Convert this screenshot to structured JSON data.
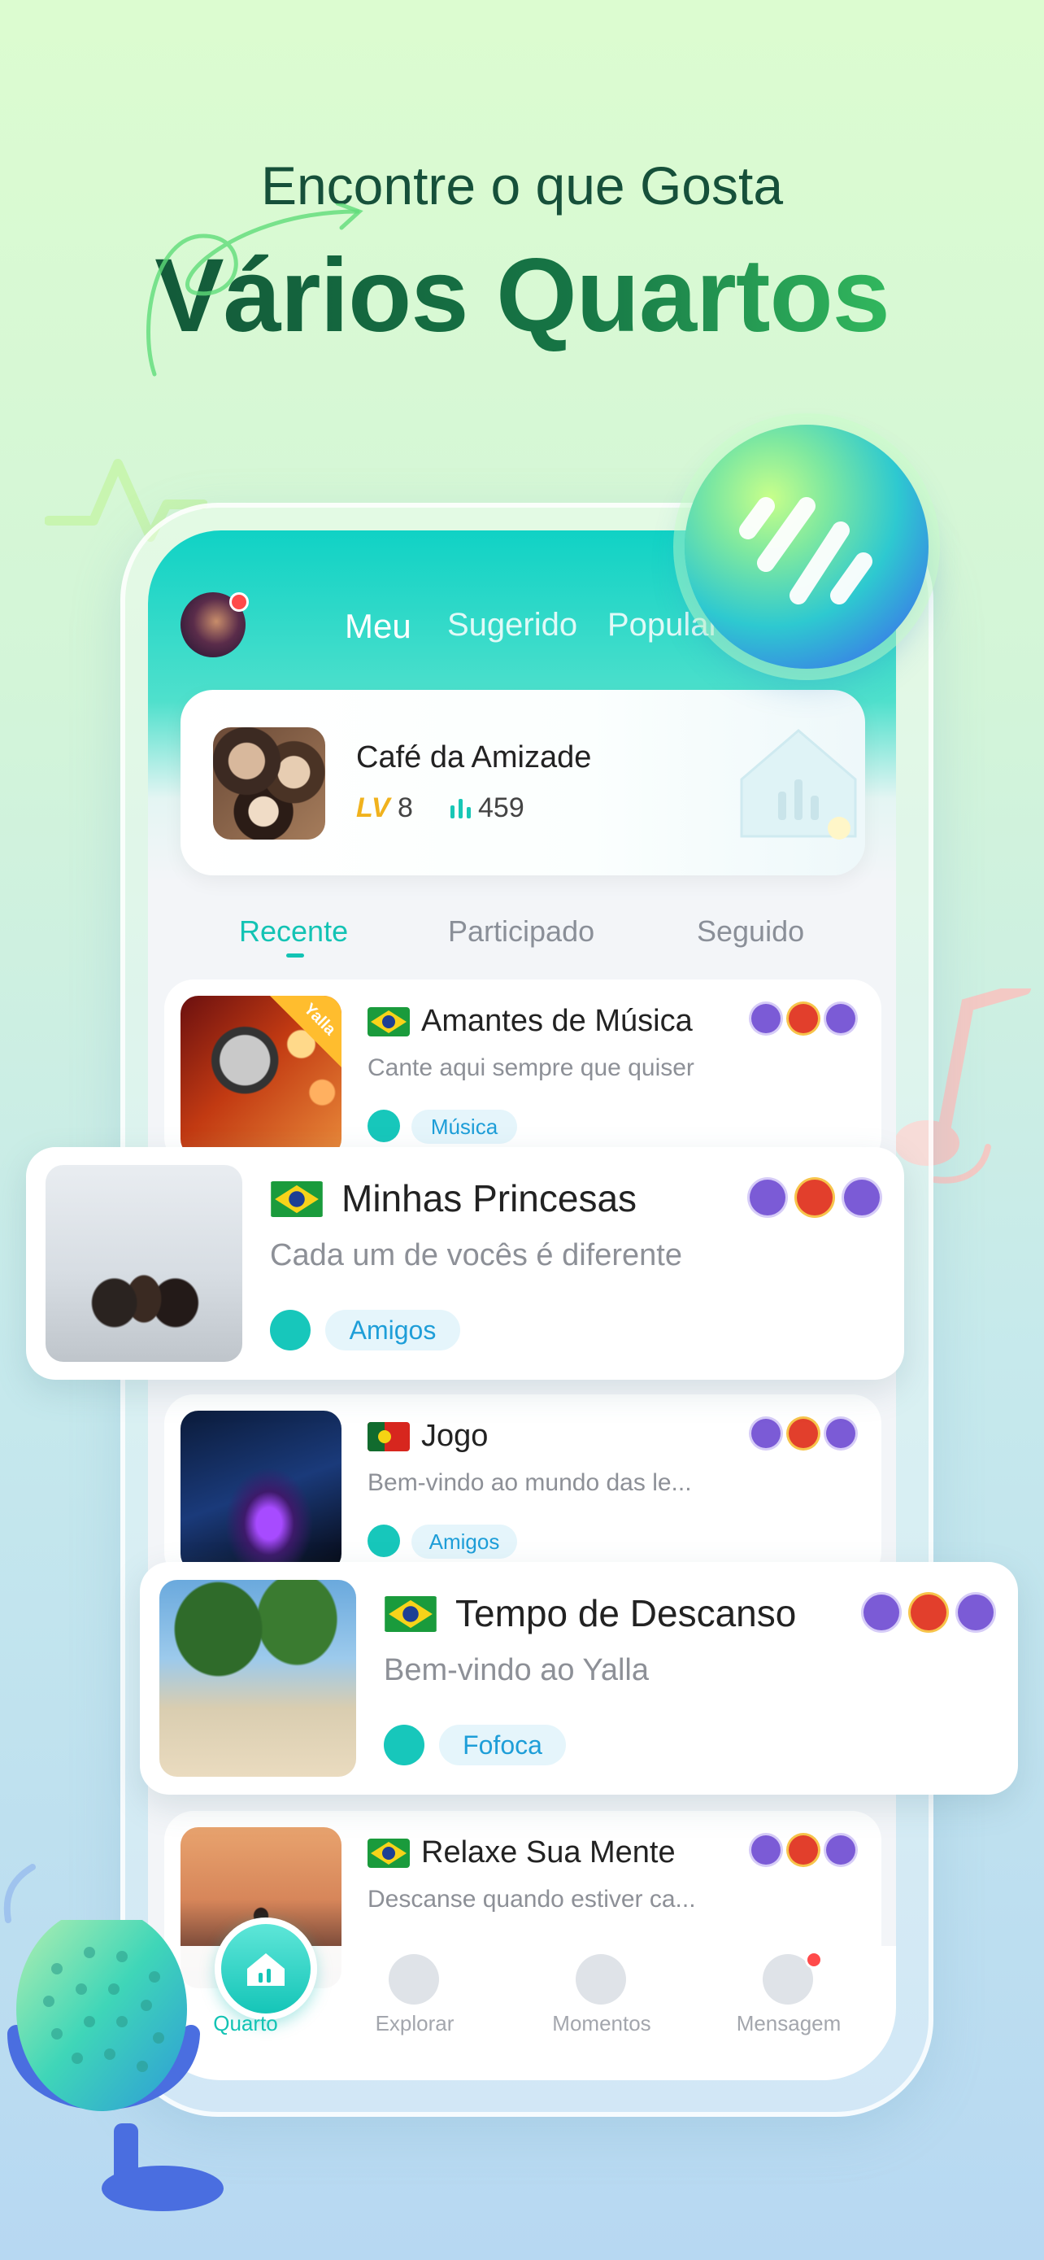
{
  "header": {
    "subtitle": "Encontre o que Gosta",
    "title": "Vários Quartos"
  },
  "top_tabs": [
    {
      "label": "Meu"
    },
    {
      "label": "Sugerido"
    },
    {
      "label": "Popular"
    }
  ],
  "favorite_room": {
    "name": "Café da Amizade",
    "level_mark": "LV",
    "level": "8",
    "count": "459"
  },
  "sub_tabs": [
    {
      "label": "Recente"
    },
    {
      "label": "Participado"
    },
    {
      "label": "Seguido"
    }
  ],
  "rooms": [
    {
      "title": "Amantes de Música",
      "description": "Cante aqui sempre que quiser",
      "tag": "Música",
      "corner_badge": "Yalla"
    },
    {
      "title": "Minhas Princesas",
      "description": "Cada um de vocês é diferente",
      "tag": "Amigos"
    },
    {
      "title": "Jogo",
      "description": "Bem-vindo ao mundo das le...",
      "tag": "Amigos"
    },
    {
      "title": "Tempo de Descanso",
      "description": "Bem-vindo ao Yalla",
      "tag": "Fofoca"
    },
    {
      "title": "Relaxe Sua Mente",
      "description": "Descanse quando estiver ca...",
      "tag": ""
    }
  ],
  "bottom_nav": [
    {
      "label": "Quarto"
    },
    {
      "label": "Explorar"
    },
    {
      "label": "Momentos"
    },
    {
      "label": "Mensagem"
    }
  ],
  "colors": {
    "accent": "#13c3b4",
    "tag_text": "#1e9ed8",
    "headline_dark": "#125035",
    "headline_green": "#3fd86a"
  }
}
